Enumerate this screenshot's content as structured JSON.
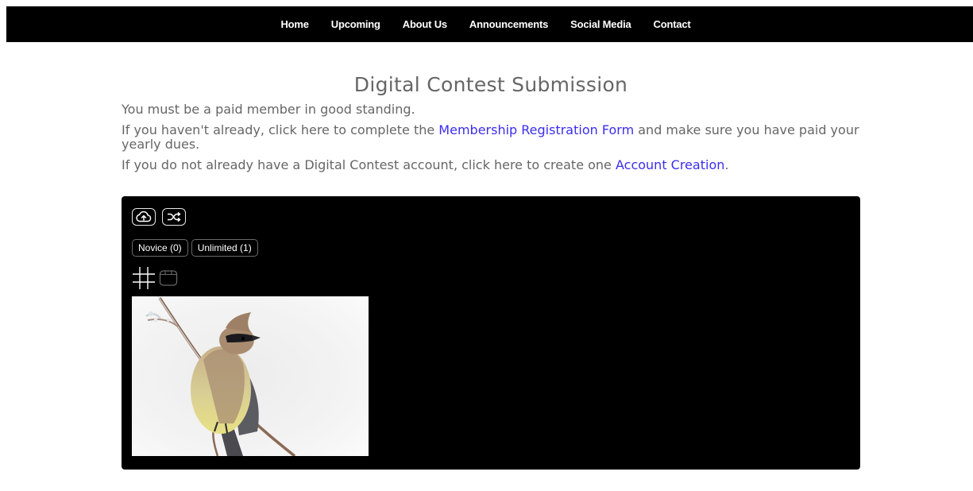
{
  "nav": {
    "items": [
      "Home",
      "Upcoming",
      "About Us",
      "Announcements",
      "Social Media",
      "Contact"
    ]
  },
  "page": {
    "title": "Digital Contest Submission",
    "line1": "You must be a paid member in good standing.",
    "line2_pre": "If you haven't already, click here to complete the ",
    "line2_link": "Membership Registration Form",
    "line2_post": " and make sure you have paid your yearly dues.",
    "line3_pre": "If you do not already have a Digital Contest account, click here to create one ",
    "line3_link": "Account Creation",
    "line3_post": "."
  },
  "gallery": {
    "toolbar_icons": [
      "cloud-upload-icon",
      "shuffle-icon"
    ],
    "categories": [
      {
        "label": "Novice (0)"
      },
      {
        "label": "Unlimited (1)"
      }
    ],
    "view_icons": [
      "grid-view-icon",
      "calendar-view-icon"
    ]
  },
  "colors": {
    "nav_bg": "#000000",
    "text": "#666666",
    "link": "#3b2df0",
    "panel_bg": "#000000"
  }
}
